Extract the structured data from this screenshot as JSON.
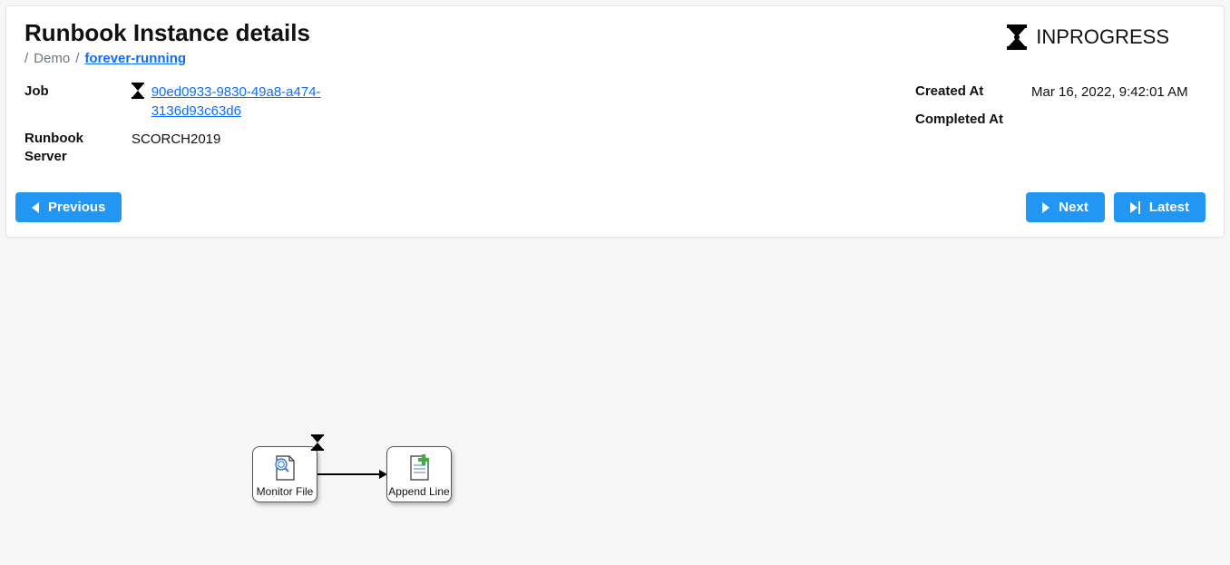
{
  "header": {
    "title": "Runbook Instance details",
    "status_label": "INPROGRESS"
  },
  "breadcrumb": {
    "item1": "Demo",
    "item2": "forever-running"
  },
  "details": {
    "job_label": "Job",
    "job_link": "90ed0933-9830-49a8-a474-3136d93c63d6",
    "server_label": "Runbook Server",
    "server_value": "SCORCH2019",
    "created_label": "Created At",
    "created_value": "Mar 16, 2022, 9:42:01 AM",
    "completed_label": "Completed At",
    "completed_value": ""
  },
  "buttons": {
    "previous": "Previous",
    "next": "Next",
    "latest": "Latest"
  },
  "graph": {
    "node1_label": "Monitor File",
    "node2_label": "Append Line"
  }
}
